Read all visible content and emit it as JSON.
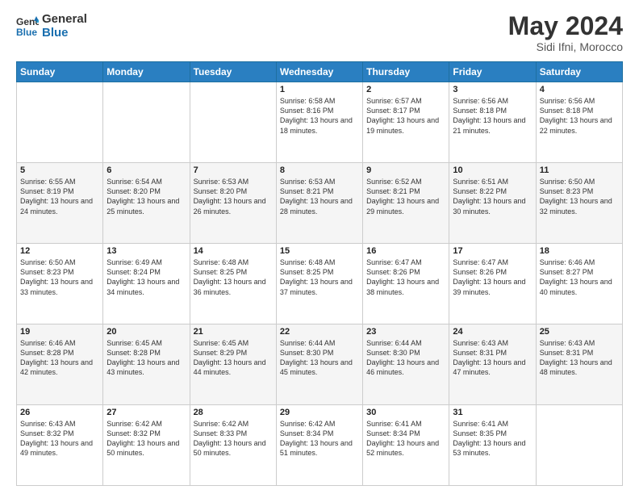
{
  "header": {
    "logo_line1": "General",
    "logo_line2": "Blue",
    "month_year": "May 2024",
    "location": "Sidi Ifni, Morocco"
  },
  "weekdays": [
    "Sunday",
    "Monday",
    "Tuesday",
    "Wednesday",
    "Thursday",
    "Friday",
    "Saturday"
  ],
  "weeks": [
    [
      {
        "day": "",
        "info": ""
      },
      {
        "day": "",
        "info": ""
      },
      {
        "day": "",
        "info": ""
      },
      {
        "day": "1",
        "info": "Sunrise: 6:58 AM\nSunset: 8:16 PM\nDaylight: 13 hours and 18 minutes."
      },
      {
        "day": "2",
        "info": "Sunrise: 6:57 AM\nSunset: 8:17 PM\nDaylight: 13 hours and 19 minutes."
      },
      {
        "day": "3",
        "info": "Sunrise: 6:56 AM\nSunset: 8:18 PM\nDaylight: 13 hours and 21 minutes."
      },
      {
        "day": "4",
        "info": "Sunrise: 6:56 AM\nSunset: 8:18 PM\nDaylight: 13 hours and 22 minutes."
      }
    ],
    [
      {
        "day": "5",
        "info": "Sunrise: 6:55 AM\nSunset: 8:19 PM\nDaylight: 13 hours and 24 minutes."
      },
      {
        "day": "6",
        "info": "Sunrise: 6:54 AM\nSunset: 8:20 PM\nDaylight: 13 hours and 25 minutes."
      },
      {
        "day": "7",
        "info": "Sunrise: 6:53 AM\nSunset: 8:20 PM\nDaylight: 13 hours and 26 minutes."
      },
      {
        "day": "8",
        "info": "Sunrise: 6:53 AM\nSunset: 8:21 PM\nDaylight: 13 hours and 28 minutes."
      },
      {
        "day": "9",
        "info": "Sunrise: 6:52 AM\nSunset: 8:21 PM\nDaylight: 13 hours and 29 minutes."
      },
      {
        "day": "10",
        "info": "Sunrise: 6:51 AM\nSunset: 8:22 PM\nDaylight: 13 hours and 30 minutes."
      },
      {
        "day": "11",
        "info": "Sunrise: 6:50 AM\nSunset: 8:23 PM\nDaylight: 13 hours and 32 minutes."
      }
    ],
    [
      {
        "day": "12",
        "info": "Sunrise: 6:50 AM\nSunset: 8:23 PM\nDaylight: 13 hours and 33 minutes."
      },
      {
        "day": "13",
        "info": "Sunrise: 6:49 AM\nSunset: 8:24 PM\nDaylight: 13 hours and 34 minutes."
      },
      {
        "day": "14",
        "info": "Sunrise: 6:48 AM\nSunset: 8:25 PM\nDaylight: 13 hours and 36 minutes."
      },
      {
        "day": "15",
        "info": "Sunrise: 6:48 AM\nSunset: 8:25 PM\nDaylight: 13 hours and 37 minutes."
      },
      {
        "day": "16",
        "info": "Sunrise: 6:47 AM\nSunset: 8:26 PM\nDaylight: 13 hours and 38 minutes."
      },
      {
        "day": "17",
        "info": "Sunrise: 6:47 AM\nSunset: 8:26 PM\nDaylight: 13 hours and 39 minutes."
      },
      {
        "day": "18",
        "info": "Sunrise: 6:46 AM\nSunset: 8:27 PM\nDaylight: 13 hours and 40 minutes."
      }
    ],
    [
      {
        "day": "19",
        "info": "Sunrise: 6:46 AM\nSunset: 8:28 PM\nDaylight: 13 hours and 42 minutes."
      },
      {
        "day": "20",
        "info": "Sunrise: 6:45 AM\nSunset: 8:28 PM\nDaylight: 13 hours and 43 minutes."
      },
      {
        "day": "21",
        "info": "Sunrise: 6:45 AM\nSunset: 8:29 PM\nDaylight: 13 hours and 44 minutes."
      },
      {
        "day": "22",
        "info": "Sunrise: 6:44 AM\nSunset: 8:30 PM\nDaylight: 13 hours and 45 minutes."
      },
      {
        "day": "23",
        "info": "Sunrise: 6:44 AM\nSunset: 8:30 PM\nDaylight: 13 hours and 46 minutes."
      },
      {
        "day": "24",
        "info": "Sunrise: 6:43 AM\nSunset: 8:31 PM\nDaylight: 13 hours and 47 minutes."
      },
      {
        "day": "25",
        "info": "Sunrise: 6:43 AM\nSunset: 8:31 PM\nDaylight: 13 hours and 48 minutes."
      }
    ],
    [
      {
        "day": "26",
        "info": "Sunrise: 6:43 AM\nSunset: 8:32 PM\nDaylight: 13 hours and 49 minutes."
      },
      {
        "day": "27",
        "info": "Sunrise: 6:42 AM\nSunset: 8:32 PM\nDaylight: 13 hours and 50 minutes."
      },
      {
        "day": "28",
        "info": "Sunrise: 6:42 AM\nSunset: 8:33 PM\nDaylight: 13 hours and 50 minutes."
      },
      {
        "day": "29",
        "info": "Sunrise: 6:42 AM\nSunset: 8:34 PM\nDaylight: 13 hours and 51 minutes."
      },
      {
        "day": "30",
        "info": "Sunrise: 6:41 AM\nSunset: 8:34 PM\nDaylight: 13 hours and 52 minutes."
      },
      {
        "day": "31",
        "info": "Sunrise: 6:41 AM\nSunset: 8:35 PM\nDaylight: 13 hours and 53 minutes."
      },
      {
        "day": "",
        "info": ""
      }
    ]
  ]
}
